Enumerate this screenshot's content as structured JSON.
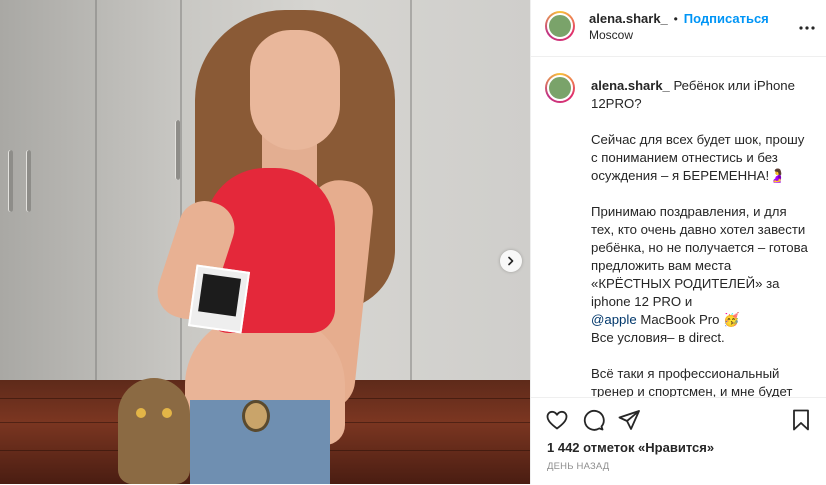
{
  "header": {
    "username": "alena.shark_",
    "separator": "•",
    "follow_label": "Подписаться",
    "location": "Moscow"
  },
  "caption": {
    "username": "alena.shark_",
    "title": "Ребёнок или iPhone 12PRO?",
    "paragraphs": [
      "Сейчас для всех будет шок, прошу с пониманием отнестись и без осуждения – я БЕРЕМЕННА!🤰",
      "Принимаю поздравления, и для тех, кто очень давно хотел завести ребёнка, но не получается – готова предложить вам места «КРЁСТНЫХ РОДИТЕЛЕЙ» за iphone 12 PRO и",
      "@apple",
      "MacBook Pro 🥳",
      "Все условия– в direct.",
      "Всё таки я профессиональный тренер и спортсмен, и мне будет тяжело одной с ребёнком, а с iphone 12PRO и КРЁСТНЫМИ– немного легче и мне и моему"
    ]
  },
  "actions": {
    "likes_text": "1 442 отметок «Нравится»",
    "time_text": "ДЕНЬ НАЗАД"
  },
  "icons": {
    "more": "more-options-icon",
    "next": "chevron-right-icon",
    "like": "heart-icon",
    "comment": "comment-icon",
    "share": "paper-plane-icon",
    "save": "bookmark-icon"
  },
  "colors": {
    "follow": "#0095f6",
    "text": "#262626",
    "muted": "#8e8e8e",
    "mention": "#00376b",
    "top": "#e4283a"
  }
}
